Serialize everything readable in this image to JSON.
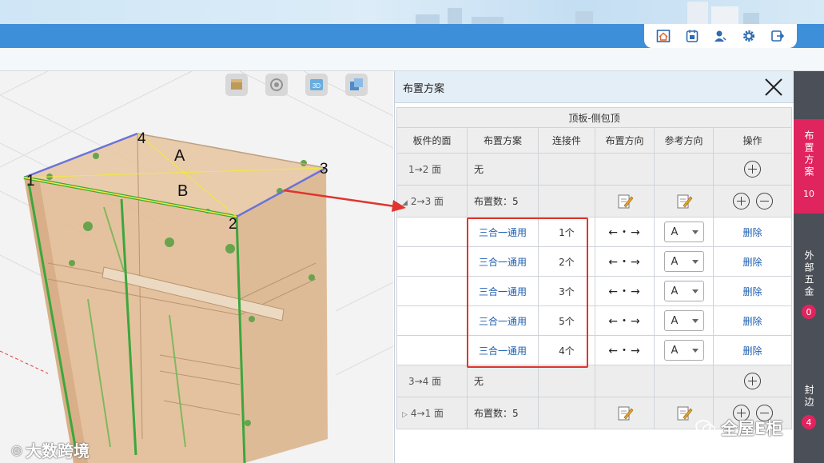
{
  "toolbar_icons": [
    "home-icon",
    "calendar-icon",
    "user-icon",
    "gear-icon",
    "logout-icon"
  ],
  "viewer": {
    "labels": {
      "p1": "1",
      "p2": "2",
      "p3": "3",
      "p4": "4",
      "a": "A",
      "b": "B"
    },
    "tools": [
      "box-icon",
      "target-icon",
      "3d-icon",
      "layers-icon"
    ]
  },
  "dialog": {
    "title": "布置方案",
    "caption": "顶板-侧包顶",
    "headers": [
      "板件的面",
      "布置方案",
      "连接件",
      "布置方向",
      "参考方向",
      "操作"
    ],
    "face1": {
      "label": "1→2 面",
      "scheme": "无"
    },
    "face2": {
      "label": "2→3 面",
      "scheme": "布置数：5"
    },
    "subrows": [
      {
        "scheme": "三合一通用",
        "count": "1个",
        "dir": "←・→",
        "ref": "A",
        "op": "删除"
      },
      {
        "scheme": "三合一通用",
        "count": "2个",
        "dir": "←・→",
        "ref": "A",
        "op": "删除"
      },
      {
        "scheme": "三合一通用",
        "count": "3个",
        "dir": "←・→",
        "ref": "A",
        "op": "删除"
      },
      {
        "scheme": "三合一通用",
        "count": "5个",
        "dir": "←・→",
        "ref": "A",
        "op": "删除"
      },
      {
        "scheme": "三合一通用",
        "count": "4个",
        "dir": "←・→",
        "ref": "A",
        "op": "删除"
      }
    ],
    "face3": {
      "label": "3→4 面",
      "scheme": "无"
    },
    "face4": {
      "label": "4→1 面",
      "scheme": "布置数：5"
    }
  },
  "sidebar": {
    "tabs": [
      {
        "label": "布置方案",
        "count": "10"
      },
      {
        "label": "外部五金",
        "count": "0"
      },
      {
        "label": "封边",
        "count": "4"
      }
    ]
  },
  "watermarks": {
    "left": "大数跨境",
    "right": "全屋E柜"
  },
  "colors": {
    "accent_blue": "#3e8fda",
    "active_tab": "#e0245e",
    "link_blue": "#1e5fb0",
    "highlight_red": "#e0342d"
  }
}
